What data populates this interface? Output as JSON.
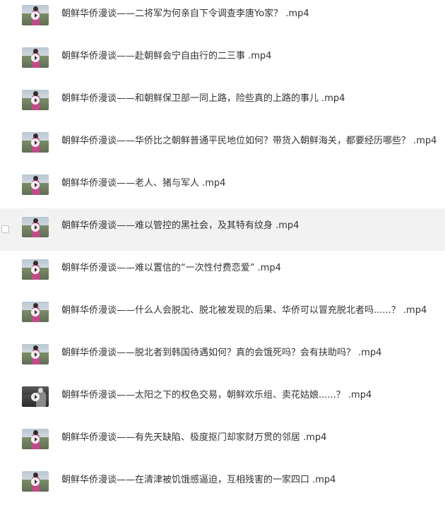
{
  "files": [
    {
      "name": "朝鲜华侨漫谈——二将军为何亲自下令调查李唐Yo家？ .mp4",
      "thumb_style": "light"
    },
    {
      "name": "朝鲜华侨漫谈——赴朝鲜会宁自由行的二三事 .mp4",
      "thumb_style": "light"
    },
    {
      "name": "朝鲜华侨漫谈——和朝鲜保卫部一同上路，险些真的上路的事儿 .mp4",
      "thumb_style": "light"
    },
    {
      "name": "朝鲜华侨漫谈——华侨比之朝鲜普通平民地位如何？带货入朝鲜海关，都要经历哪些？ .mp4",
      "thumb_style": "light"
    },
    {
      "name": "朝鲜华侨漫谈——老人、猪与军人 .mp4",
      "thumb_style": "light"
    },
    {
      "name": "朝鲜华侨漫谈——难以管控的黑社会，及其特有纹身 .mp4",
      "thumb_style": "light",
      "hovered": true
    },
    {
      "name": "朝鲜华侨漫谈——难以置信的“一次性付费恋爱” .mp4",
      "thumb_style": "light"
    },
    {
      "name": "朝鲜华侨漫谈——什么人会脱北、脱北被发现的后果、华侨可以冒充脱北者吗......？ .mp4",
      "thumb_style": "light"
    },
    {
      "name": "朝鲜华侨漫谈——脱北者到韩国待遇如何？真的会饿死吗？会有扶助吗？ .mp4",
      "thumb_style": "light"
    },
    {
      "name": "朝鲜华侨漫谈——太阳之下的权色交易，朝鲜欢乐组、卖花姑娘......？ .mp4",
      "thumb_style": "dark"
    },
    {
      "name": "朝鲜华侨漫谈——有先天缺陷、极度抠门却家财万贯的邻居 .mp4",
      "thumb_style": "light"
    },
    {
      "name": "朝鲜华侨漫谈——在清津被饥饿感逼迫，互相残害的一家四口 .mp4",
      "thumb_style": "light"
    }
  ]
}
